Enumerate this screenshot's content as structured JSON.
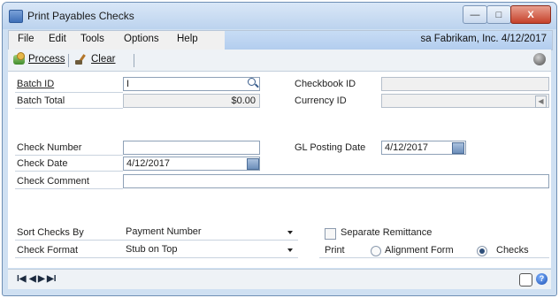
{
  "window": {
    "title": "Print Payables Checks",
    "controls": {
      "minimize": "—",
      "maximize": "□",
      "close": "X"
    }
  },
  "menu": {
    "items": [
      "File",
      "Edit",
      "Tools",
      "Options",
      "Help"
    ],
    "user_info": "sa  Fabrikam, Inc.  4/12/2017"
  },
  "toolbar": {
    "process_label": "Process",
    "clear_label": "Clear"
  },
  "form": {
    "batch_id": {
      "label": "Batch ID",
      "value": "I"
    },
    "batch_total": {
      "label": "Batch Total",
      "value": "$0.00"
    },
    "checkbook_id": {
      "label": "Checkbook ID",
      "value": ""
    },
    "currency_id": {
      "label": "Currency ID",
      "value": ""
    },
    "check_number": {
      "label": "Check Number",
      "value": ""
    },
    "check_date": {
      "label": "Check Date",
      "value": "4/12/2017"
    },
    "gl_posting_date": {
      "label": "GL Posting Date",
      "value": "4/12/2017"
    },
    "check_comment": {
      "label": "Check Comment",
      "value": ""
    },
    "sort_checks_by": {
      "label": "Sort Checks By",
      "value": "Payment Number"
    },
    "check_format": {
      "label": "Check Format",
      "value": "Stub on Top"
    },
    "separate_remittance": {
      "label": "Separate Remittance",
      "checked": false
    },
    "print": {
      "label": "Print",
      "options": [
        "Alignment Form",
        "Checks"
      ],
      "selected": "Checks"
    }
  },
  "footer": {
    "nav": {
      "first": "I◀",
      "prev": "◀",
      "next": "▶",
      "last": "▶I"
    },
    "help": "?"
  },
  "colors": {
    "window_frame": "#cfe0f2",
    "title_gradient_top": "#d9e7f7",
    "menu_highlight": "#b3cdee",
    "close_button": "#c5412a"
  }
}
